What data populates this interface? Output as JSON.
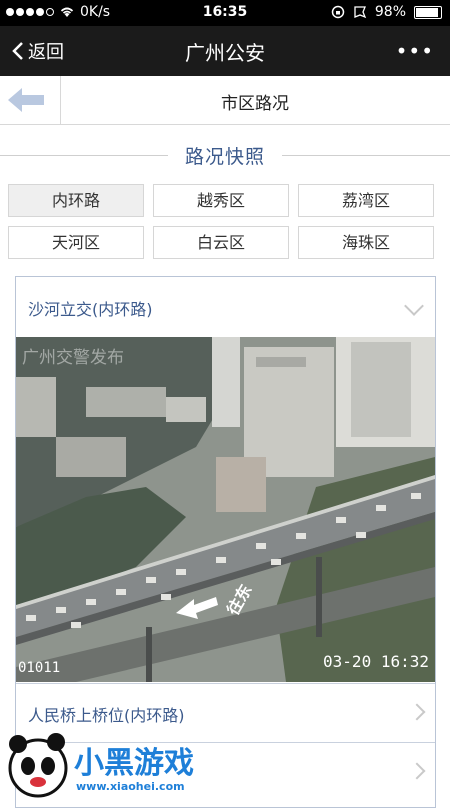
{
  "status_bar": {
    "carrier_signal": "●●●●○",
    "network": "0K/s",
    "time": "16:35",
    "battery": "98%"
  },
  "nav": {
    "back_label": "返回",
    "title": "广州公安",
    "more_label": "•••"
  },
  "subheader": {
    "title": "市区路况"
  },
  "section": {
    "title": "路况快照"
  },
  "districts": [
    "内环路",
    "越秀区",
    "荔湾区",
    "天河区",
    "白云区",
    "海珠区"
  ],
  "active_district": "内环路",
  "panel": {
    "expanded_item": "沙河立交(内环路)",
    "camera": {
      "overlay_title": "广州交警发布",
      "camera_id": "01011",
      "timestamp": "03-20 16:32",
      "direction_label": "往东"
    },
    "items": [
      "人民桥上桥位(内环路)",
      ""
    ]
  },
  "watermark": {
    "text": "小黑游戏",
    "url": "www.xiaohei.com"
  }
}
